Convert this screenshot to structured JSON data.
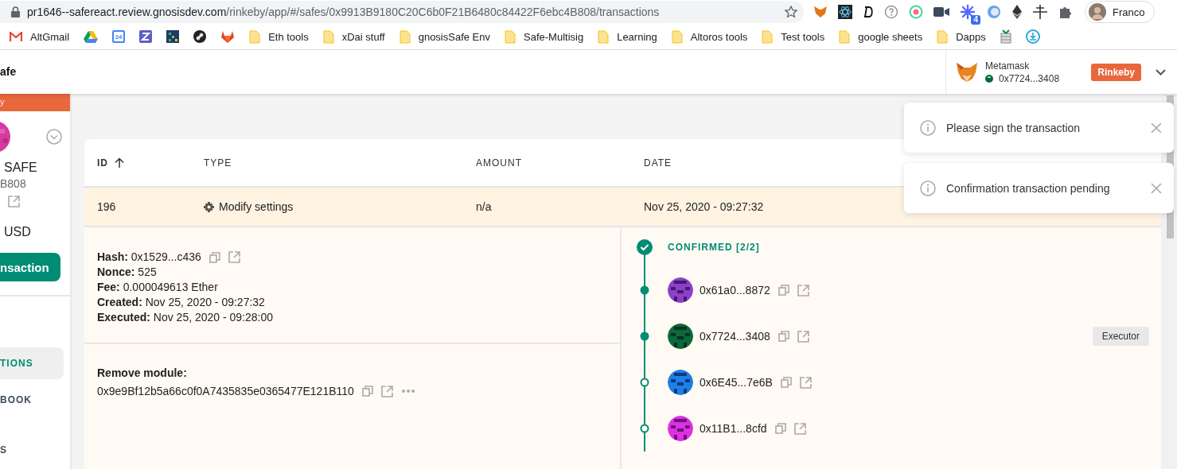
{
  "browser": {
    "url_host": "pr1646--safereact.review.gnosisdev.com",
    "url_path": "/rinkeby/app/#/safes/0x9913B9180C20C6b0F21B6480c84422F6ebc4B808/transactions",
    "extension_badge": "4",
    "profile": "Franco",
    "bookmarks": [
      {
        "kind": "gmail",
        "label": "AltGmail"
      },
      {
        "kind": "drive"
      },
      {
        "kind": "calendar",
        "label": "24"
      },
      {
        "kind": "zapp"
      },
      {
        "kind": "grid"
      },
      {
        "kind": "link"
      },
      {
        "kind": "gitlab"
      },
      {
        "kind": "folder",
        "label": "Eth tools"
      },
      {
        "kind": "folder",
        "label": "xDai stuff"
      },
      {
        "kind": "folder",
        "label": "gnosisSafe Env"
      },
      {
        "kind": "folder",
        "label": "Safe-Multisig"
      },
      {
        "kind": "folder",
        "label": "Learning"
      },
      {
        "kind": "folder",
        "label": "Altoros tools"
      },
      {
        "kind": "folder",
        "label": "Test tools"
      },
      {
        "kind": "folder",
        "label": "google sheets"
      },
      {
        "kind": "folder",
        "label": "Dapps"
      },
      {
        "kind": "gift"
      },
      {
        "kind": "drop"
      }
    ]
  },
  "header": {
    "logo_text": "afe",
    "wallet": {
      "name": "Metamask",
      "address": "0x7724...3408",
      "network": "Rinkeby"
    }
  },
  "sidebar": {
    "network_banner": "y",
    "safe_name": "SAFE",
    "safe_address": "B808",
    "balance": "USD",
    "new_tx_button": "nsaction",
    "items": [
      {
        "label": "TIONS",
        "selected": true
      },
      {
        "label": "BOOK",
        "selected": false
      },
      {
        "label": "S",
        "selected": false
      }
    ]
  },
  "table": {
    "columns": [
      {
        "label": "ID",
        "sorted": true
      },
      {
        "label": "TYPE",
        "sorted": false
      },
      {
        "label": "AMOUNT",
        "sorted": false
      },
      {
        "label": "DATE",
        "sorted": false
      }
    ],
    "rows": [
      {
        "id": "196",
        "type": "Modify settings",
        "amount": "n/a",
        "date": "Nov 25, 2020 - 09:27:32",
        "expanded": true
      }
    ],
    "details": {
      "fields": [
        {
          "label": "Hash:",
          "value": "0x1529...c436",
          "links": true
        },
        {
          "label": "Nonce:",
          "value": "525",
          "links": false
        },
        {
          "label": "Fee:",
          "value": "0.000049613 Ether",
          "links": false
        },
        {
          "label": "Created:",
          "value": "Nov 25, 2020 - 09:27:32",
          "links": false
        },
        {
          "label": "Executed:",
          "value": "Nov 25, 2020 - 09:28:00",
          "links": false
        }
      ],
      "method": {
        "title": "Remove module:",
        "address": "0x9e9Bf12b5a66c0f0A7435835e0365477E121B110"
      }
    },
    "timeline": {
      "status": "CONFIRMED [2/2]",
      "owners": [
        {
          "address": "0x61a0...8872",
          "confirmed": true,
          "color": "#8e3fc8"
        },
        {
          "address": "0x7724...3408",
          "confirmed": true,
          "color": "#0b6a35",
          "role": "Executor"
        },
        {
          "address": "0x6E45...7e6B",
          "confirmed": false,
          "color": "#1f7fe6"
        },
        {
          "address": "0x11B1...8cfd",
          "confirmed": false,
          "color": "#e02fe0"
        }
      ]
    }
  },
  "toasts": [
    {
      "message": "Please sign the transaction"
    },
    {
      "message": "Confirmation transaction pending"
    }
  ]
}
